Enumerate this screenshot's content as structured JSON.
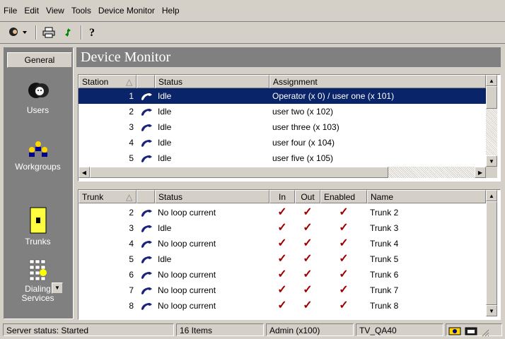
{
  "menu": [
    "File",
    "Edit",
    "View",
    "Tools",
    "Device Monitor",
    "Help"
  ],
  "toolbar": {
    "icons": [
      "user-dropdown-icon",
      "print-icon",
      "refresh-icon",
      "help-icon"
    ]
  },
  "left_pane": {
    "tab_label": "General",
    "items": [
      {
        "label": "Users"
      },
      {
        "label": "Workgroups"
      },
      {
        "label": "Trunks"
      },
      {
        "label": "Dialing Services"
      }
    ]
  },
  "header": {
    "title": "Device Monitor"
  },
  "stations": {
    "columns": [
      "Station",
      "Status",
      "Assignment"
    ],
    "rows": [
      {
        "num": "1",
        "status": "Idle",
        "assignment": "Operator (x 0) / user one (x 101)",
        "selected": true
      },
      {
        "num": "2",
        "status": "Idle",
        "assignment": "user two (x 102)"
      },
      {
        "num": "3",
        "status": "Idle",
        "assignment": "user three (x 103)"
      },
      {
        "num": "4",
        "status": "Idle",
        "assignment": "user four (x 104)"
      },
      {
        "num": "5",
        "status": "Idle",
        "assignment": "user five (x 105)"
      }
    ]
  },
  "trunks": {
    "columns": [
      "Trunk",
      "Status",
      "In",
      "Out",
      "Enabled",
      "Name"
    ],
    "rows": [
      {
        "num": "2",
        "status": "No loop current",
        "name": "Trunk 2"
      },
      {
        "num": "3",
        "status": "Idle",
        "name": "Trunk 3"
      },
      {
        "num": "4",
        "status": "No loop current",
        "name": "Trunk 4"
      },
      {
        "num": "5",
        "status": "Idle",
        "name": "Trunk 5"
      },
      {
        "num": "6",
        "status": "No loop current",
        "name": "Trunk 6"
      },
      {
        "num": "7",
        "status": "No loop current",
        "name": "Trunk 7"
      },
      {
        "num": "8",
        "status": "No loop current",
        "name": "Trunk 8"
      }
    ]
  },
  "status_bar": {
    "server": "Server status: Started",
    "items": "16 Items",
    "user": "Admin (x100)",
    "system": "TV_QA40"
  },
  "colors": {
    "selection": "#0a246a",
    "check": "#a00000",
    "phone": "#1a237e"
  }
}
